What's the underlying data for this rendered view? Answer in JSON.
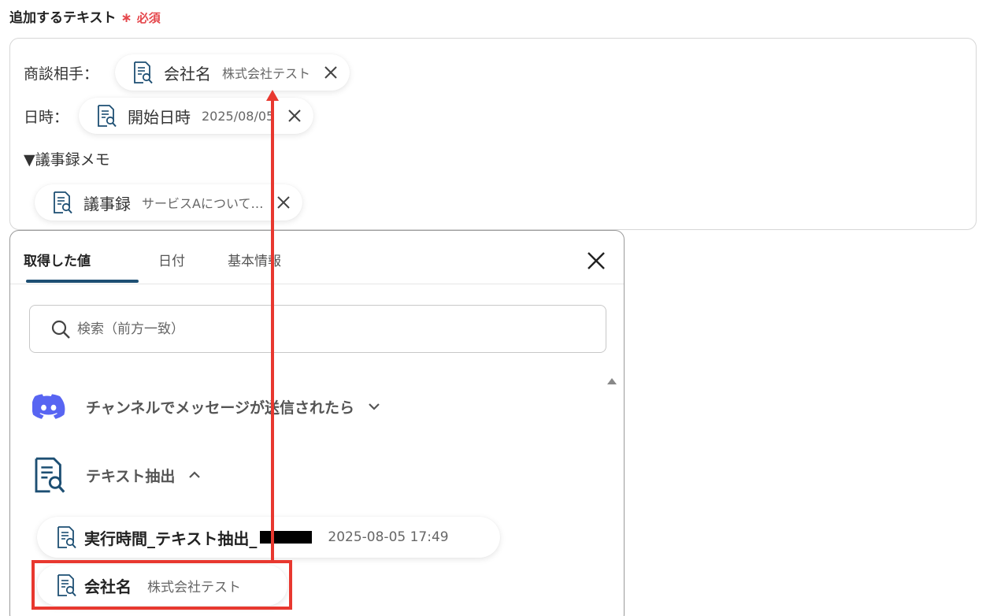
{
  "field": {
    "label": "追加するテキスト",
    "required_star": "∗",
    "required_label": "必須"
  },
  "text_box": {
    "line1_label": "商談相手：",
    "line2_label": "日時：",
    "line3_label": "▼議事録メモ",
    "chips": [
      {
        "name": "会社名",
        "value": "株式会社テスト"
      },
      {
        "name": "開始日時",
        "value": "2025/08/05"
      },
      {
        "name": "議事録",
        "value": "サービスAについて…"
      }
    ]
  },
  "panel": {
    "tabs": [
      {
        "label": "取得した値",
        "active": true
      },
      {
        "label": "日付",
        "active": false
      },
      {
        "label": "基本情報",
        "active": false
      }
    ],
    "search_placeholder": "検索（前方一致）",
    "groups": [
      {
        "label": "チャンネルでメッセージが送信されたら",
        "icon": "discord-icon",
        "expanded": false
      },
      {
        "label": "テキスト抽出",
        "icon": "doc-search-icon",
        "expanded": true
      }
    ],
    "items": [
      {
        "name": "実行時間_テキスト抽出_",
        "value": "2025-08-05 17:49",
        "redacted": true
      },
      {
        "name": "会社名",
        "value": "株式会社テスト",
        "redacted": false
      }
    ]
  },
  "colors": {
    "accent_tab": "#1d4f73",
    "doc_icon": "#1d4f73",
    "discord": "#5865f2",
    "required": "#e5484d",
    "annotation": "#e8382f"
  }
}
